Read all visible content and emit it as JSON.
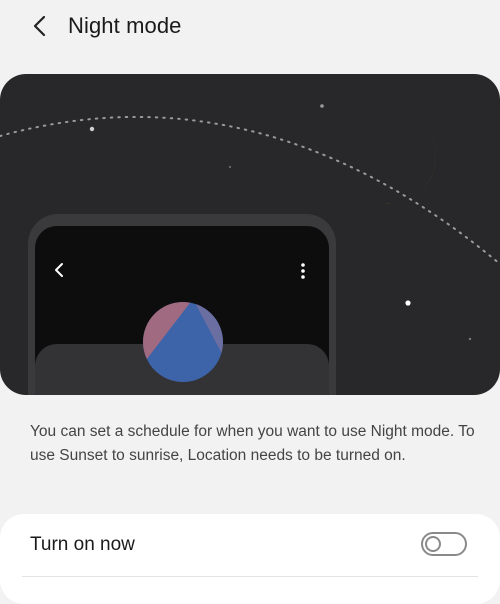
{
  "header": {
    "back_icon": "chevron-left-icon",
    "title": "Night mode"
  },
  "illustration": {
    "icons": [
      "crescent-moon-icon",
      "phone-back-icon",
      "more-vert-icon",
      "sunset-circle-icon"
    ],
    "colors": {
      "background": "#28282a",
      "moon": "#f5c400",
      "phone_frame": "#3a3a3c",
      "phone_screen": "#0d0d0d",
      "circle_blue": "#3d63a8",
      "circle_pink": "#a06a80"
    }
  },
  "description": "You can set a schedule for when you want to use Night mode. To use Sunset to sunrise, Location needs to be turned on.",
  "settings": {
    "turn_on_now": {
      "label": "Turn on now",
      "enabled": false
    }
  }
}
